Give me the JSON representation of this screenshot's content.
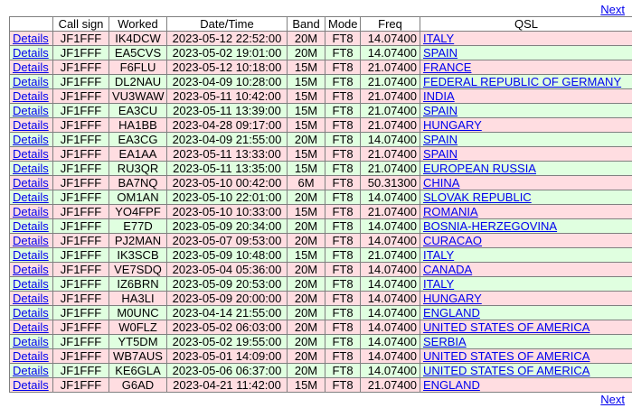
{
  "nav": {
    "next_label": "Next"
  },
  "columns": [
    "",
    "Call sign",
    "Worked",
    "Date/Time",
    "Band",
    "Mode",
    "Freq",
    "QSL"
  ],
  "details_label": "Details",
  "row_colors": {
    "pink": "#ffdde1",
    "green": "#e0ffe0",
    "link": "#0000ee"
  },
  "rows": [
    {
      "call": "JF1FFF",
      "worked": "IK4DCW",
      "datetime": "2023-05-12 22:52:00",
      "band": "20M",
      "mode": "FT8",
      "freq": "14.07400",
      "qsl": "ITALY",
      "shade": "pink"
    },
    {
      "call": "JF1FFF",
      "worked": "EA5CVS",
      "datetime": "2023-05-02 19:01:00",
      "band": "20M",
      "mode": "FT8",
      "freq": "14.07400",
      "qsl": "SPAIN",
      "shade": "green"
    },
    {
      "call": "JF1FFF",
      "worked": "F6FLU",
      "datetime": "2023-05-12 10:18:00",
      "band": "15M",
      "mode": "FT8",
      "freq": "21.07400",
      "qsl": "FRANCE",
      "shade": "pink"
    },
    {
      "call": "JF1FFF",
      "worked": "DL2NAU",
      "datetime": "2023-04-09 10:28:00",
      "band": "15M",
      "mode": "FT8",
      "freq": "21.07400",
      "qsl": "FEDERAL REPUBLIC OF GERMANY",
      "shade": "green"
    },
    {
      "call": "JF1FFF",
      "worked": "VU3WAW",
      "datetime": "2023-05-11 10:42:00",
      "band": "15M",
      "mode": "FT8",
      "freq": "21.07400",
      "qsl": "INDIA",
      "shade": "pink"
    },
    {
      "call": "JF1FFF",
      "worked": "EA3CU",
      "datetime": "2023-05-11 13:39:00",
      "band": "15M",
      "mode": "FT8",
      "freq": "21.07400",
      "qsl": "SPAIN",
      "shade": "green"
    },
    {
      "call": "JF1FFF",
      "worked": "HA1BB",
      "datetime": "2023-04-28 09:17:00",
      "band": "15M",
      "mode": "FT8",
      "freq": "21.07400",
      "qsl": "HUNGARY",
      "shade": "pink"
    },
    {
      "call": "JF1FFF",
      "worked": "EA3CG",
      "datetime": "2023-04-09 21:55:00",
      "band": "20M",
      "mode": "FT8",
      "freq": "14.07400",
      "qsl": "SPAIN",
      "shade": "green"
    },
    {
      "call": "JF1FFF",
      "worked": "EA1AA",
      "datetime": "2023-05-11 13:33:00",
      "band": "15M",
      "mode": "FT8",
      "freq": "21.07400",
      "qsl": "SPAIN",
      "shade": "pink"
    },
    {
      "call": "JF1FFF",
      "worked": "RU3QR",
      "datetime": "2023-05-11 13:35:00",
      "band": "15M",
      "mode": "FT8",
      "freq": "21.07400",
      "qsl": "EUROPEAN RUSSIA",
      "shade": "green"
    },
    {
      "call": "JF1FFF",
      "worked": "BA7NQ",
      "datetime": "2023-05-10 00:42:00",
      "band": "6M",
      "mode": "FT8",
      "freq": "50.31300",
      "qsl": "CHINA",
      "shade": "pink"
    },
    {
      "call": "JF1FFF",
      "worked": "OM1AN",
      "datetime": "2023-05-10 22:01:00",
      "band": "20M",
      "mode": "FT8",
      "freq": "14.07400",
      "qsl": "SLOVAK REPUBLIC",
      "shade": "green"
    },
    {
      "call": "JF1FFF",
      "worked": "YO4FPF",
      "datetime": "2023-05-10 10:33:00",
      "band": "15M",
      "mode": "FT8",
      "freq": "21.07400",
      "qsl": "ROMANIA",
      "shade": "pink"
    },
    {
      "call": "JF1FFF",
      "worked": "E77D",
      "datetime": "2023-05-09 20:34:00",
      "band": "20M",
      "mode": "FT8",
      "freq": "14.07400",
      "qsl": "BOSNIA-HERZEGOVINA",
      "shade": "green"
    },
    {
      "call": "JF1FFF",
      "worked": "PJ2MAN",
      "datetime": "2023-05-07 09:53:00",
      "band": "20M",
      "mode": "FT8",
      "freq": "14.07400",
      "qsl": "CURACAO",
      "shade": "pink"
    },
    {
      "call": "JF1FFF",
      "worked": "IK3SCB",
      "datetime": "2023-05-09 10:48:00",
      "band": "15M",
      "mode": "FT8",
      "freq": "21.07400",
      "qsl": "ITALY",
      "shade": "green"
    },
    {
      "call": "JF1FFF",
      "worked": "VE7SDQ",
      "datetime": "2023-05-04 05:36:00",
      "band": "20M",
      "mode": "FT8",
      "freq": "14.07400",
      "qsl": "CANADA",
      "shade": "pink"
    },
    {
      "call": "JF1FFF",
      "worked": "IZ6BRN",
      "datetime": "2023-05-09 20:53:00",
      "band": "20M",
      "mode": "FT8",
      "freq": "14.07400",
      "qsl": "ITALY",
      "shade": "green"
    },
    {
      "call": "JF1FFF",
      "worked": "HA3LI",
      "datetime": "2023-05-09 20:00:00",
      "band": "20M",
      "mode": "FT8",
      "freq": "14.07400",
      "qsl": "HUNGARY",
      "shade": "pink"
    },
    {
      "call": "JF1FFF",
      "worked": "M0UNC",
      "datetime": "2023-04-14 21:55:00",
      "band": "20M",
      "mode": "FT8",
      "freq": "14.07400",
      "qsl": "ENGLAND",
      "shade": "green"
    },
    {
      "call": "JF1FFF",
      "worked": "W0FLZ",
      "datetime": "2023-05-02 06:03:00",
      "band": "20M",
      "mode": "FT8",
      "freq": "14.07400",
      "qsl": "UNITED STATES OF AMERICA",
      "shade": "pink"
    },
    {
      "call": "JF1FFF",
      "worked": "YT5DM",
      "datetime": "2023-05-02 19:55:00",
      "band": "20M",
      "mode": "FT8",
      "freq": "14.07400",
      "qsl": "SERBIA",
      "shade": "green"
    },
    {
      "call": "JF1FFF",
      "worked": "WB7AUS",
      "datetime": "2023-05-01 14:09:00",
      "band": "20M",
      "mode": "FT8",
      "freq": "14.07400",
      "qsl": "UNITED STATES OF AMERICA",
      "shade": "pink"
    },
    {
      "call": "JF1FFF",
      "worked": "KE6GLA",
      "datetime": "2023-05-06 06:37:00",
      "band": "20M",
      "mode": "FT8",
      "freq": "14.07400",
      "qsl": "UNITED STATES OF AMERICA",
      "shade": "green"
    },
    {
      "call": "JF1FFF",
      "worked": "G6AD",
      "datetime": "2023-04-21 11:42:00",
      "band": "15M",
      "mode": "FT8",
      "freq": "21.07400",
      "qsl": "ENGLAND",
      "shade": "pink"
    }
  ]
}
